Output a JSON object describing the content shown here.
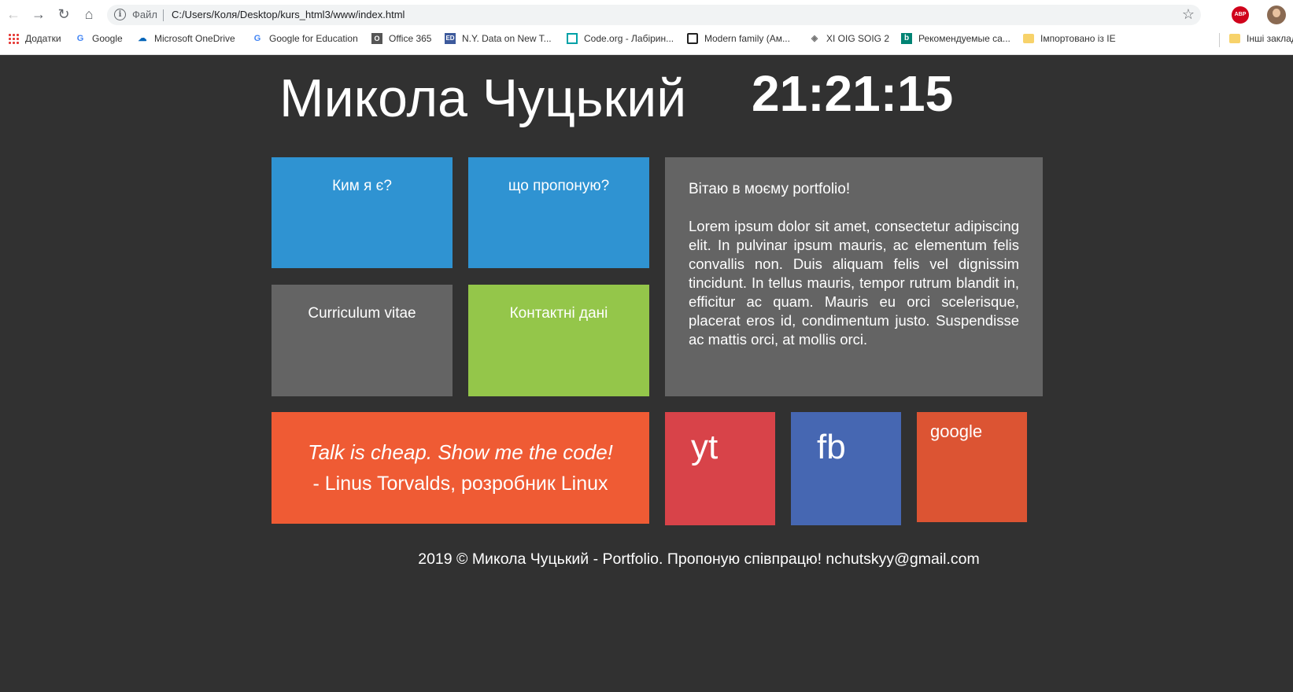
{
  "browser": {
    "file_label": "Файл",
    "url": "C:/Users/Коля/Desktop/kurs_html3/www/index.html",
    "abp_label": "ABP",
    "bookmarks": [
      {
        "label": "Додатки",
        "icon": "apps-grid-icon"
      },
      {
        "label": "Google",
        "icon": "google-icon"
      },
      {
        "label": "Microsoft OneDrive",
        "icon": "onedrive-cloud-icon"
      },
      {
        "label": "Google for Education",
        "icon": "google-icon"
      },
      {
        "label": "Office 365",
        "icon": "office-icon"
      },
      {
        "label": "N.Y. Data on New T...",
        "icon": "ed-icon"
      },
      {
        "label": "Code.org - Лабірин...",
        "icon": "code-org-icon"
      },
      {
        "label": "Modern family (Ам...",
        "icon": "tv-icon"
      },
      {
        "label": "XI OIG SOIG 2",
        "icon": "shield-icon"
      },
      {
        "label": "Рекомендуемые са...",
        "icon": "bing-icon"
      },
      {
        "label": "Імпортовано із IE",
        "icon": "folder-icon"
      },
      {
        "label": "Інші заклад",
        "icon": "folder-icon"
      }
    ]
  },
  "page": {
    "name": "Микола Чуцький",
    "clock": "21:21:15",
    "tiles": {
      "about": "Ким я є?",
      "offer": "що пропоную?",
      "cv": "Curriculum vitae",
      "contact": "Контактні дані",
      "yt": "yt",
      "fb": "fb",
      "google": "google"
    },
    "welcome": {
      "title": "Вітаю в моєму portfolio!",
      "text": "Lorem ipsum dolor sit amet, consectetur adipiscing elit. In pulvinar ipsum mauris, ac elementum felis convallis non. Duis aliquam felis vel dignissim tincidunt. In tellus mauris, tempor rutrum blandit in, efficitur ac quam. Mauris eu orci scelerisque, placerat eros id, condimentum justo. Suspendisse ac mattis orci, at mollis orci."
    },
    "quote": {
      "line": "Talk is cheap. Show me the code!",
      "author": "- Linus Torvalds, розробник Linux"
    },
    "footer": "2019 © Микола Чуцький - Portfolio. Пропоную співпрацю! nchutskyy@gmail.com"
  },
  "colors": {
    "background": "#313131",
    "blue": "#2f93d2",
    "gray": "#646464",
    "green": "#94c64a",
    "orange": "#ef5b34",
    "yt_red": "#d84349",
    "fb_blue": "#4667b2",
    "google_orange": "#dc5433"
  }
}
